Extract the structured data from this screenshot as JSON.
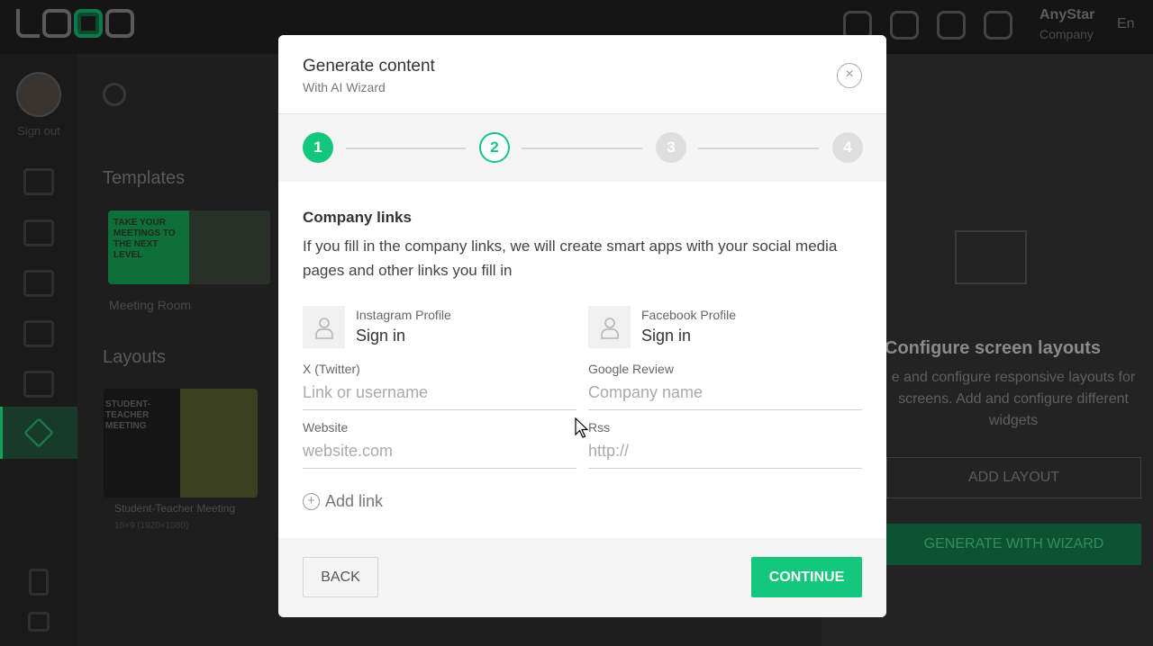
{
  "app": {
    "account_name": "AnyStar",
    "account_role": "Company",
    "language": "En",
    "sign_out": "Sign out"
  },
  "background": {
    "templates_title": "Templates",
    "template_card_text": "TAKE YOUR MEETINGS TO THE NEXT LEVEL",
    "template_card_label": "Meeting Room",
    "layouts_title": "Layouts",
    "layout_card_text": "STUDENT-TEACHER MEETING",
    "layout_card_label": "Student-Teacher Meeting",
    "layout_card_size": "16×9 (1920×1080)",
    "right_panel": {
      "title": "Configure screen layouts",
      "description": "e and configure responsive layouts for screens. Add and configure different widgets",
      "add_layout": "ADD LAYOUT",
      "generate": "GENERATE WITH WIZARD"
    }
  },
  "modal": {
    "title": "Generate content",
    "subtitle": "With AI Wizard",
    "close_symbol": "×",
    "steps": [
      {
        "label": "1",
        "state": "done"
      },
      {
        "label": "2",
        "state": "current"
      },
      {
        "label": "3",
        "state": "todo"
      },
      {
        "label": "4",
        "state": "todo"
      }
    ],
    "section_title": "Company links",
    "section_description": "If you fill in the company links, we will create smart apps with your social media pages and other links you fill in",
    "profiles": [
      {
        "label": "Instagram Profile",
        "action": "Sign in"
      },
      {
        "label": "Facebook Profile",
        "action": "Sign in"
      }
    ],
    "fields": {
      "twitter": {
        "label": "X (Twitter)",
        "value": "",
        "placeholder": "Link or username"
      },
      "google": {
        "label": "Google Review",
        "value": "",
        "placeholder": "Company name"
      },
      "website": {
        "label": "Website",
        "value": "",
        "placeholder": "website.com"
      },
      "rss": {
        "label": "Rss",
        "value": "",
        "placeholder": "http://"
      }
    },
    "add_link": "Add link",
    "add_link_symbol": "+",
    "back": "BACK",
    "continue": "CONTINUE"
  },
  "colors": {
    "accent": "#13c77d",
    "step_todo": "#dedede"
  }
}
